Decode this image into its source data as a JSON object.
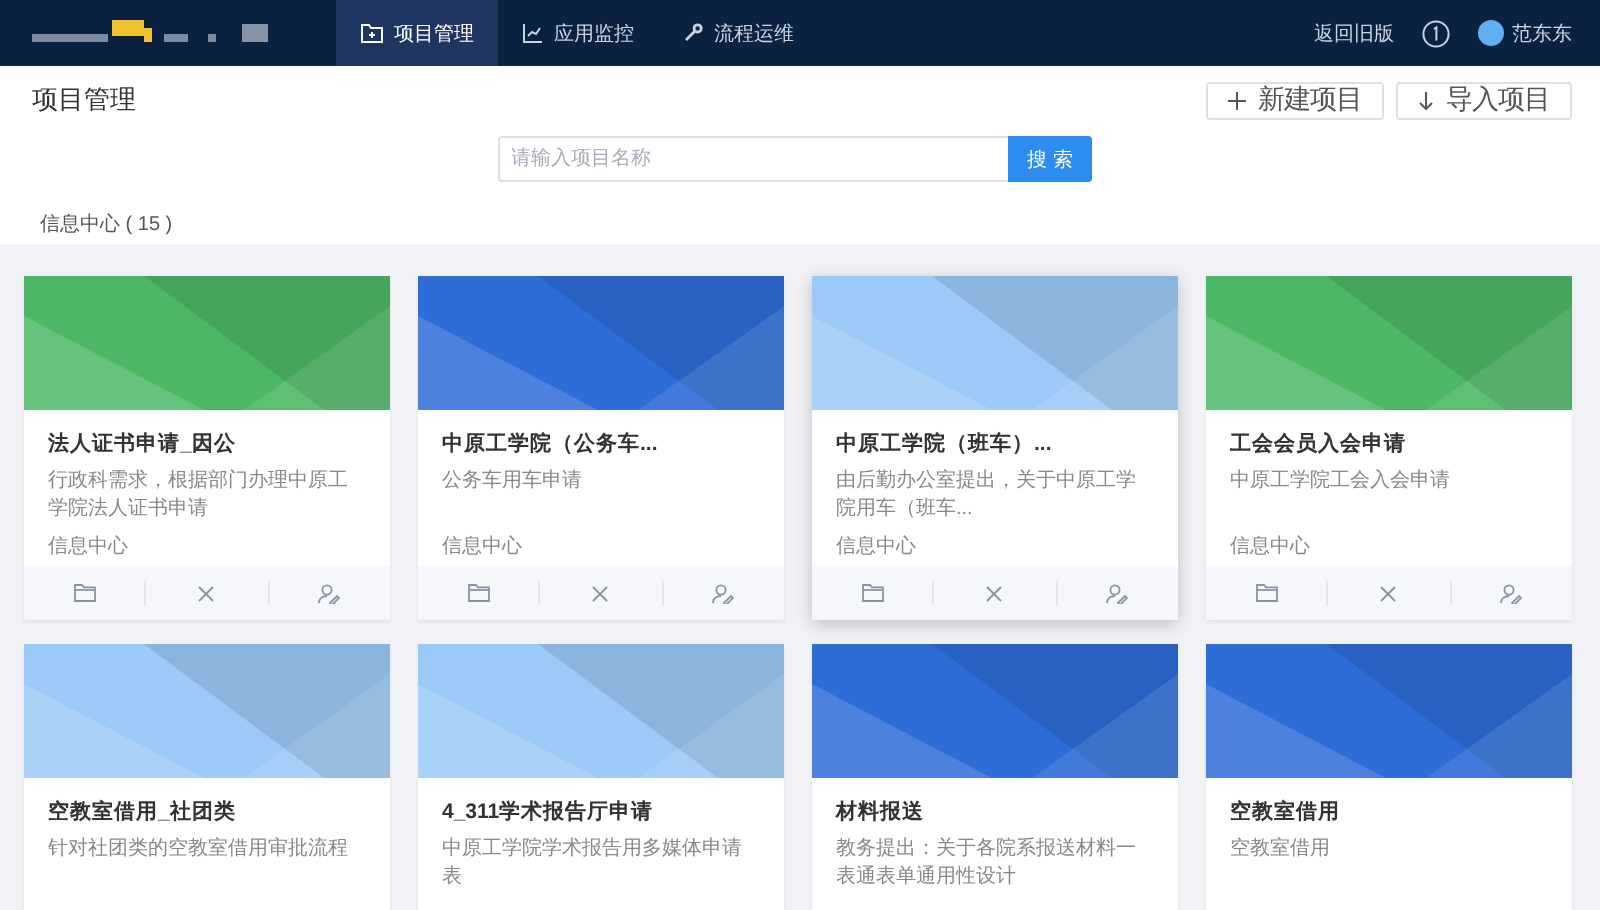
{
  "nav": {
    "tabs": [
      {
        "label": "项目管理",
        "selected": true
      },
      {
        "label": "应用监控",
        "selected": false
      },
      {
        "label": "流程运维",
        "selected": false
      }
    ],
    "links": [
      "返回旧版"
    ],
    "user": "范东东"
  },
  "page": {
    "title": "项目管理",
    "buttons": [
      {
        "label": "新建项目"
      },
      {
        "label": "导入项目"
      }
    ]
  },
  "search": {
    "placeholder": "请输入项目名称",
    "button": "搜 索"
  },
  "group": "信息中心 ( 15 )",
  "cards": [
    {
      "title": "法人证书申请_因公",
      "desc": "行政科需求，根据部门办理中原工学院法人证书申请",
      "footer": "信息中心",
      "color": "#4cb866",
      "selected": false
    },
    {
      "title": "中原工学院（公务车...",
      "desc": "公务车用车申请",
      "footer": "信息中心",
      "color": "#2e6cd8",
      "selected": false
    },
    {
      "title": "中原工学院（班车）...",
      "desc": "由后勤办公室提出，关于中原工学院用车（班车...",
      "footer": "信息中心",
      "color": "#9ccaf7",
      "selected": true
    },
    {
      "title": "工会会员入会申请",
      "desc": "中原工学院工会入会申请",
      "footer": "信息中心",
      "color": "#4cb866",
      "selected": false
    },
    {
      "title": "空教室借用_社团类",
      "desc": "针对社团类的空教室借用审批流程",
      "color": "#9ccaf7",
      "selected": false
    },
    {
      "title": "4_311学术报告厅申请",
      "desc": "中原工学院学术报告用多媒体申请表",
      "color": "#9ccaf7",
      "selected": false
    },
    {
      "title": "材料报送",
      "desc": "教务提出：关于各院系报送材料一表通表单通用性设计",
      "color": "#2e6cd8",
      "selected": false
    },
    {
      "title": "空教室借用",
      "desc": "空教室借用",
      "color": "#2e6cd8",
      "selected": false
    }
  ]
}
